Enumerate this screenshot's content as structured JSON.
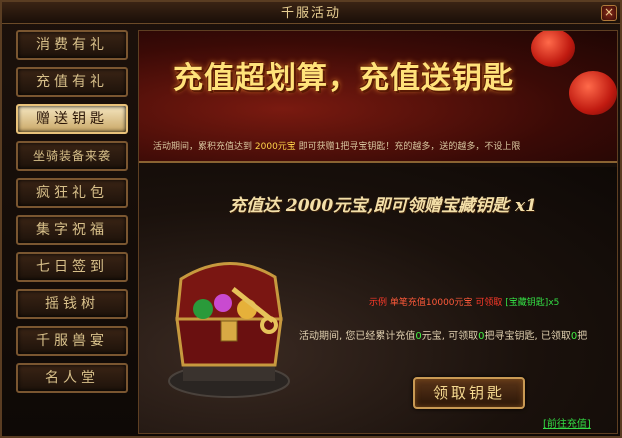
{
  "window": {
    "title": "千服活动",
    "close_glyph": "×"
  },
  "sidebar": {
    "items": [
      {
        "label": "消费有礼"
      },
      {
        "label": "充值有礼"
      },
      {
        "label": "赠送钥匙"
      },
      {
        "label": "坐骑装备来袭"
      },
      {
        "label": "疯狂礼包"
      },
      {
        "label": "集字祝福"
      },
      {
        "label": "七日签到"
      },
      {
        "label": "摇钱树"
      },
      {
        "label": "千服兽宴"
      },
      {
        "label": "名人堂"
      }
    ],
    "active_index": 2
  },
  "banner": {
    "title": "充值超划算，充值送钥匙",
    "desc_prefix": "活动期间，累积充值达到",
    "desc_amount": "2000元宝",
    "desc_suffix": "即可获赠1把寻宝钥匙！充的越多，送的越多，不设上限"
  },
  "content": {
    "headline": "充值达 2000元宝,即可领赠宝藏钥匙 x1",
    "example_label": "示例",
    "example_single": "单笔充值10000元宝",
    "example_claim": "可领取",
    "example_reward": "[宝藏钥匙]x5",
    "status_prefix": "活动期间, 您已经累计充值",
    "status_amount": "0",
    "status_mid1": "元宝, 可领取",
    "status_claimable": "0",
    "status_mid2": "把寻宝钥匙, 已领取",
    "status_claimed": "0",
    "status_suffix": "把",
    "claim_button": "领取钥匙",
    "recharge_link": "[前往充值]"
  },
  "colors": {
    "accent_gold": "#ffe27a",
    "highlight_green": "#33dd44",
    "highlight_red": "#ff3a2a",
    "active_tab_bg": "#f5e6c0"
  },
  "icons": {
    "close": "close-icon",
    "chest": "treasure-chest-icon",
    "lantern": "red-lantern-icon"
  }
}
